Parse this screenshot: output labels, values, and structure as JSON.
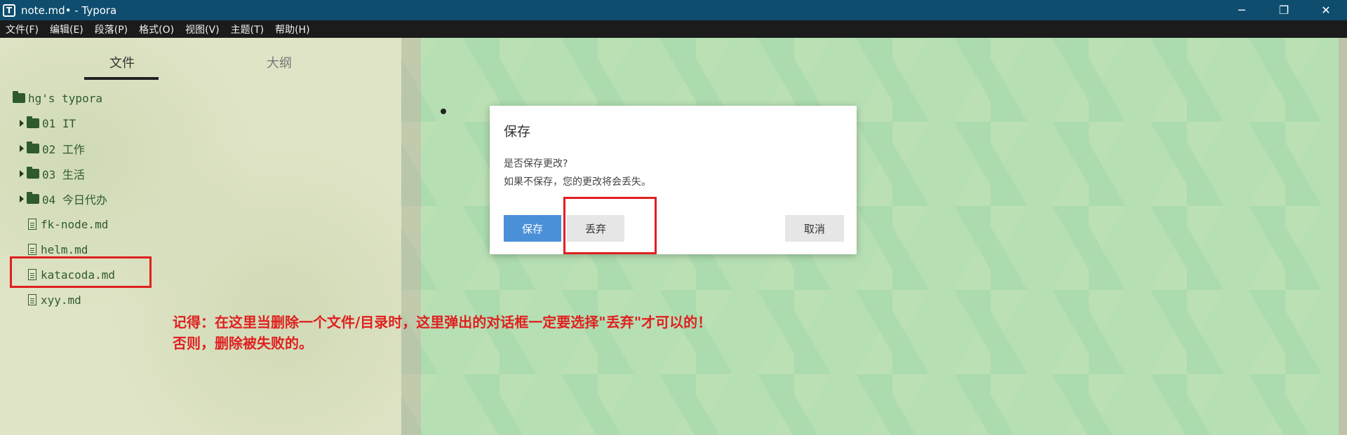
{
  "window": {
    "title": "note.md• - Typora",
    "app_icon_letter": "T"
  },
  "window_controls": {
    "minimize": "─",
    "restore": "❐",
    "close": "✕"
  },
  "menu": [
    "文件(F)",
    "编辑(E)",
    "段落(P)",
    "格式(O)",
    "视图(V)",
    "主题(T)",
    "帮助(H)"
  ],
  "sidebar": {
    "tabs": {
      "files": "文件",
      "outline": "大纲"
    },
    "root": "hg's typora",
    "folders": [
      "01 IT",
      "02 工作",
      "03 生活",
      "04 今日代办"
    ],
    "files": [
      "fk-node.md",
      "helm.md",
      "katacoda.md",
      "xyy.md"
    ]
  },
  "dialog": {
    "title": "保存",
    "message_line1": "是否保存更改?",
    "message_line2": "如果不保存，您的更改将会丢失。",
    "save_label": "保存",
    "discard_label": "丢弃",
    "cancel_label": "取消"
  },
  "annotation": {
    "line1": "记得：在这里当删除一个文件/目录时，这里弹出的对话框一定要选择\"丢弃\"才可以的！",
    "line2": "否则，删除被失败的。",
    "color": "#e02020"
  },
  "colors": {
    "titlebar": "#0e4d6e",
    "menubar": "#1b1b1b",
    "accent": "#4a90d9"
  }
}
